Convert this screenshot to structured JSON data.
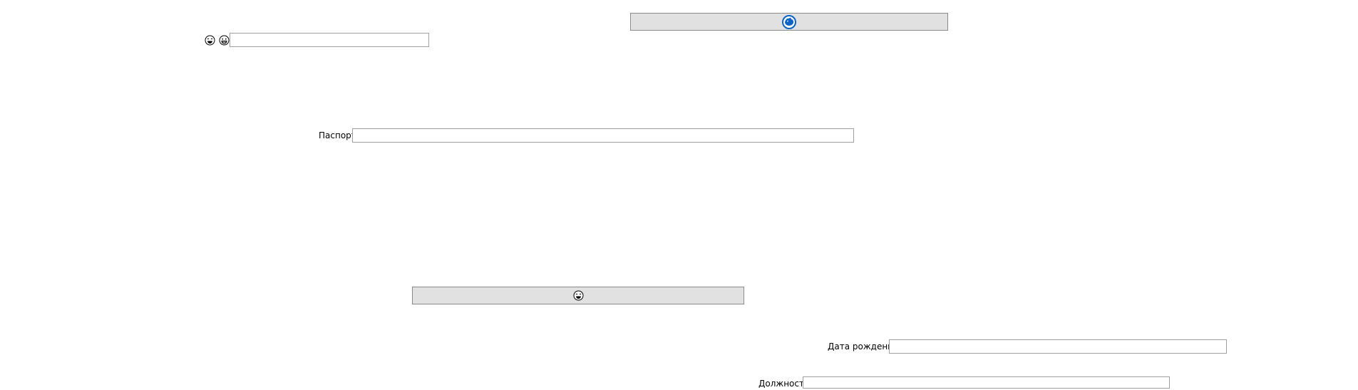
{
  "toolbar": {
    "top_button_icon": "blue-globe-icon",
    "left_icons": [
      "laughing-face-icon",
      "grinning-face-icon"
    ],
    "top_field_value": ""
  },
  "passport": {
    "label": "Паспорт",
    "value": ""
  },
  "middle_button": {
    "icon": "laughing-face-icon"
  },
  "birth_date": {
    "label": "Дата рождения",
    "value": ""
  },
  "position": {
    "label": "Должность",
    "value": ""
  },
  "colors": {
    "button_bg": "#e1e1e1",
    "button_border": "#8a8a8a",
    "field_border": "#a0a0a0",
    "globe_blue": "#0a64c8"
  }
}
